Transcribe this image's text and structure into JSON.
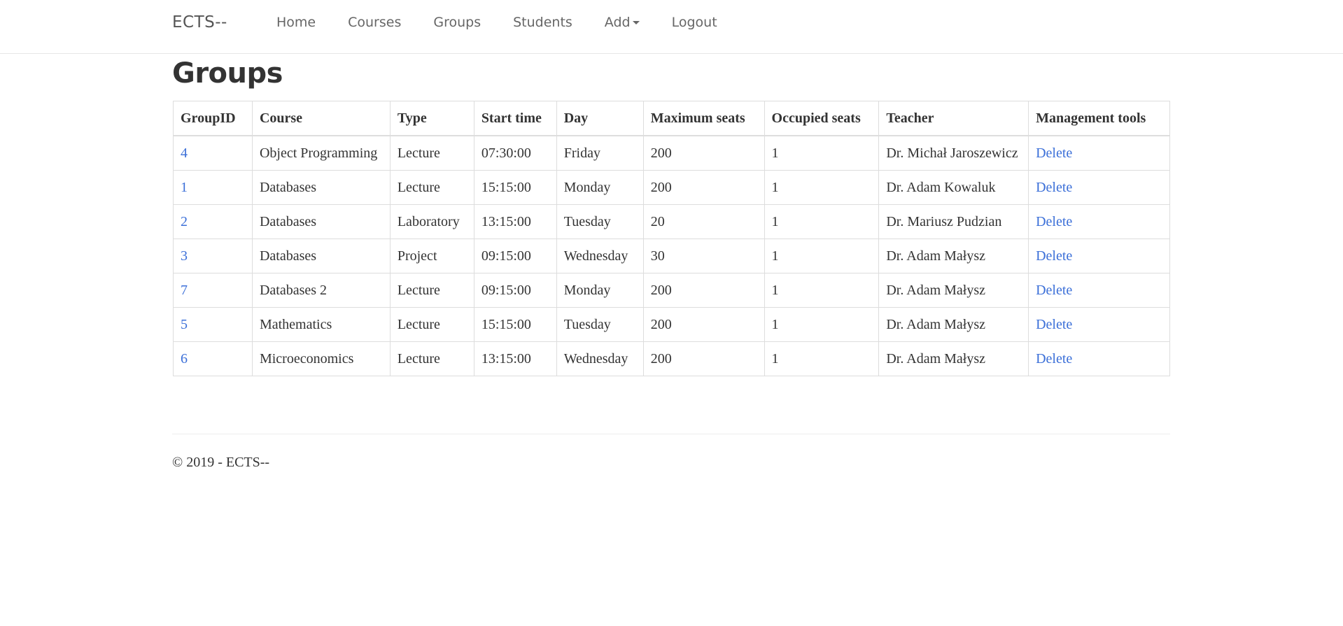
{
  "navbar": {
    "brand": "ECTS--",
    "items": [
      {
        "label": "Home"
      },
      {
        "label": "Courses"
      },
      {
        "label": "Groups"
      },
      {
        "label": "Students"
      },
      {
        "label": "Add"
      },
      {
        "label": "Logout"
      }
    ]
  },
  "page": {
    "title": "Groups"
  },
  "table": {
    "headers": {
      "group_id": "GroupID",
      "course": "Course",
      "type": "Type",
      "start_time": "Start time",
      "day": "Day",
      "max_seats": "Maximum seats",
      "occupied_seats": "Occupied seats",
      "teacher": "Teacher",
      "management": "Management tools"
    },
    "rows": [
      {
        "id": "4",
        "course": "Object Programming",
        "type": "Lecture",
        "start": "07:30:00",
        "day": "Friday",
        "max": "200",
        "occupied": "1",
        "teacher": "Dr. Michał Jaroszewicz",
        "action": "Delete"
      },
      {
        "id": "1",
        "course": "Databases",
        "type": "Lecture",
        "start": "15:15:00",
        "day": "Monday",
        "max": "200",
        "occupied": "1",
        "teacher": "Dr. Adam Kowaluk",
        "action": "Delete"
      },
      {
        "id": "2",
        "course": "Databases",
        "type": "Laboratory",
        "start": "13:15:00",
        "day": "Tuesday",
        "max": "20",
        "occupied": "1",
        "teacher": "Dr. Mariusz Pudzian",
        "action": "Delete"
      },
      {
        "id": "3",
        "course": "Databases",
        "type": "Project",
        "start": "09:15:00",
        "day": "Wednesday",
        "max": "30",
        "occupied": "1",
        "teacher": "Dr. Adam Małysz",
        "action": "Delete"
      },
      {
        "id": "7",
        "course": "Databases 2",
        "type": "Lecture",
        "start": "09:15:00",
        "day": "Monday",
        "max": "200",
        "occupied": "1",
        "teacher": "Dr. Adam Małysz",
        "action": "Delete"
      },
      {
        "id": "5",
        "course": "Mathematics",
        "type": "Lecture",
        "start": "15:15:00",
        "day": "Tuesday",
        "max": "200",
        "occupied": "1",
        "teacher": "Dr. Adam Małysz",
        "action": "Delete"
      },
      {
        "id": "6",
        "course": "Microeconomics",
        "type": "Lecture",
        "start": "13:15:00",
        "day": "Wednesday",
        "max": "200",
        "occupied": "1",
        "teacher": "Dr. Adam Małysz",
        "action": "Delete"
      }
    ]
  },
  "footer": {
    "text": "© 2019 - ECTS--"
  },
  "colors": {
    "link": "#3b6fd8",
    "text": "#333333",
    "border": "#dddddd"
  }
}
